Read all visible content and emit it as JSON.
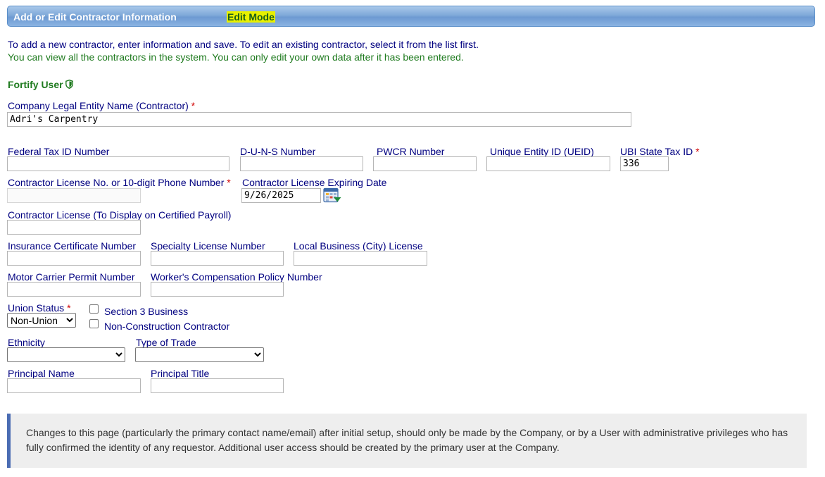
{
  "header": {
    "title": "Add or Edit Contractor Information",
    "mode": "Edit Mode"
  },
  "intro": {
    "line1": "To add a new contractor, enter information and save. To edit an existing contractor, select it from the list first.",
    "line2": "You can view all the contractors in the system. You can only edit your own data after it has been entered."
  },
  "fortify": {
    "label": "Fortify User",
    "icon": "shield-icon"
  },
  "fields": {
    "company_name": {
      "label": "Company Legal Entity Name (Contractor)",
      "value": "Adri's Carpentry",
      "required": "*"
    },
    "federal_tax_id": {
      "label": "Federal Tax ID Number",
      "value": ""
    },
    "duns": {
      "label": "D-U-N-S Number",
      "value": ""
    },
    "pwcr": {
      "label": "PWCR Number",
      "value": ""
    },
    "ueid": {
      "label": "Unique Entity ID (UEID)",
      "value": ""
    },
    "ubi": {
      "label": "UBI State Tax ID",
      "value": "336",
      "required": "*"
    },
    "license_phone": {
      "label": "Contractor License No. or 10-digit Phone Number",
      "value": "",
      "required": "*"
    },
    "license_expiry": {
      "label": "Contractor License Expiring Date",
      "value": "9/26/2025"
    },
    "license_display": {
      "label": "Contractor License (To Display on Certified Payroll)",
      "value": ""
    },
    "insurance": {
      "label": "Insurance Certificate Number",
      "value": ""
    },
    "specialty": {
      "label": "Specialty License Number",
      "value": ""
    },
    "local_business": {
      "label": "Local Business (City) License",
      "value": ""
    },
    "motor_carrier": {
      "label": "Motor Carrier Permit Number",
      "value": ""
    },
    "workers_comp": {
      "label": "Worker's Compensation Policy Number",
      "value": ""
    },
    "union_status": {
      "label": "Union Status",
      "required": "*",
      "selected": "Non-Union"
    },
    "section3": {
      "label": "Section 3 Business",
      "checked": false
    },
    "non_construction": {
      "label": "Non-Construction Contractor",
      "checked": false
    },
    "ethnicity": {
      "label": "Ethnicity",
      "selected": ""
    },
    "trade": {
      "label": "Type of Trade",
      "selected": ""
    },
    "principal_name": {
      "label": "Principal Name",
      "value": ""
    },
    "principal_title": {
      "label": "Principal Title",
      "value": ""
    }
  },
  "notice": {
    "text": "Changes to this page (particularly the primary contact name/email) after initial setup, should only be made by the Company, or by a User with administrative privileges who has fully confirmed the identity of any requestor. Additional user access should be created by the primary user at the Company."
  },
  "colors": {
    "label": "#000080",
    "required": "#d00000",
    "green": "#1e7a1e",
    "edit_mode_bg": "#e8f000",
    "notice_border": "#4a6cb3"
  }
}
